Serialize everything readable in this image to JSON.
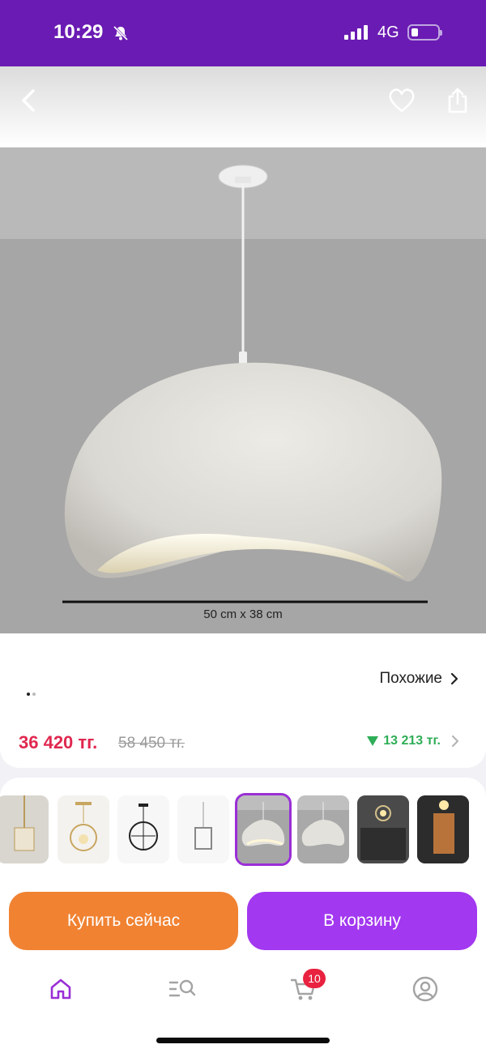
{
  "status_bar": {
    "time": "10:29",
    "network": "4G",
    "icons": [
      "bell-muted-icon",
      "signal-icon",
      "battery-icon"
    ]
  },
  "nav": {
    "icons": [
      "back-icon",
      "heart-icon",
      "share-icon"
    ]
  },
  "product_image": {
    "dimension_label": "50 cm x 38 cm",
    "carousel_page": 1,
    "carousel_total": 2
  },
  "info": {
    "similar_label": "Похожие",
    "price": "36 420 тг.",
    "old_price": "58 450 тг.",
    "saving": "13 213 тг."
  },
  "thumbnails": {
    "count": 8,
    "selected_index": 4
  },
  "actions": {
    "buy_now": "Купить сейчас",
    "add_to_cart": "В корзину"
  },
  "tabbar": {
    "tabs": [
      "home-icon",
      "catalog-search-icon",
      "cart-icon",
      "profile-icon"
    ],
    "cart_badge": "10",
    "active_tab": "home"
  },
  "colors": {
    "brand": "#6a1bb3",
    "buy": "#f08232",
    "cart": "#a238f0",
    "price": "#e0284f",
    "saving": "#2fae57"
  }
}
